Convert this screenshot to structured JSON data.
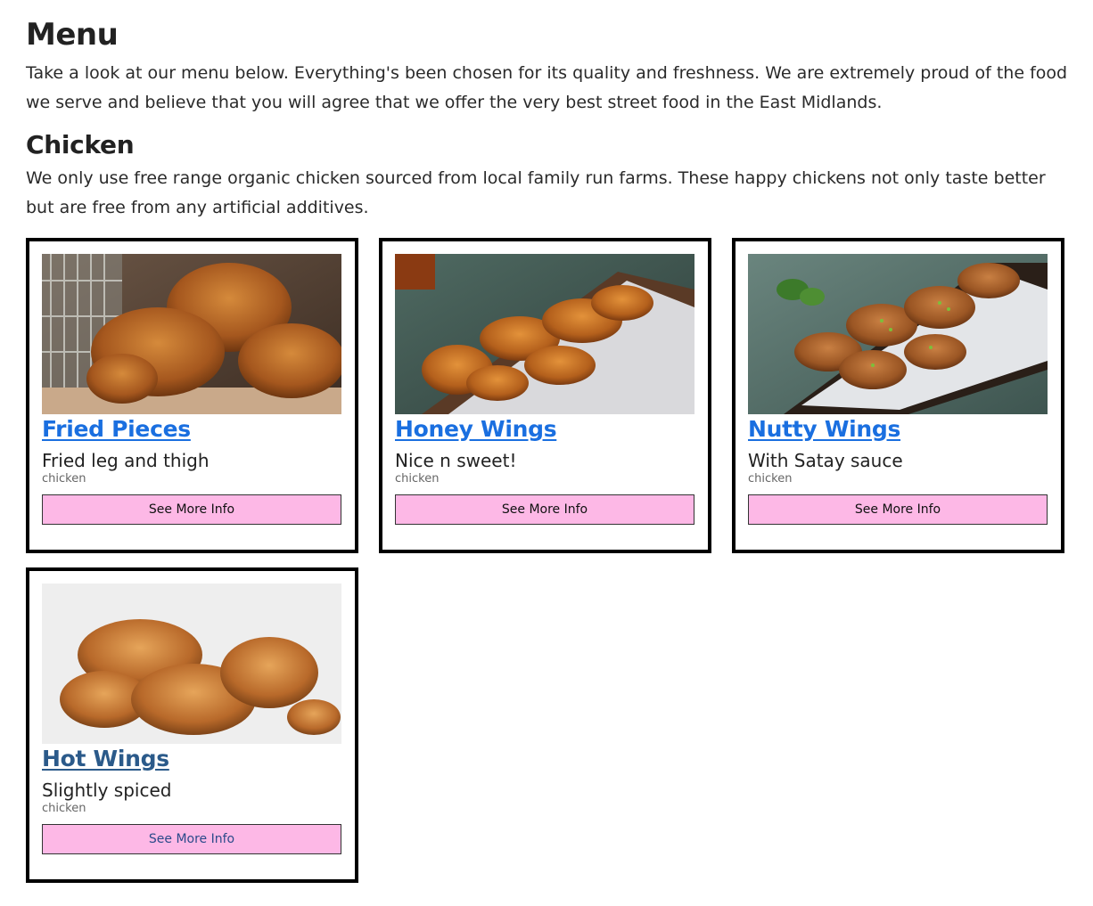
{
  "menu": {
    "title": "Menu",
    "intro": "Take a look at our menu below. Everything's been chosen for its quality and freshness. We are extremely proud of the food we serve and believe that you will agree that we offer the very best street food in the East Midlands."
  },
  "category": {
    "title": "Chicken",
    "description": "We only use free range organic chicken sourced from local family run farms. These happy chickens not only taste better but are free from any artificial additives."
  },
  "items": [
    {
      "title": "Fried Pieces",
      "description": "Fried leg and thigh",
      "category": "chicken",
      "button": "See More Info"
    },
    {
      "title": "Honey Wings",
      "description": "Nice n sweet!",
      "category": "chicken",
      "button": "See More Info"
    },
    {
      "title": "Nutty Wings",
      "description": "With Satay sauce",
      "category": "chicken",
      "button": "See More Info"
    },
    {
      "title": "Hot Wings",
      "description": "Slightly spiced",
      "category": "chicken",
      "button": "See More Info"
    }
  ],
  "colors": {
    "link": "#1a6fe0",
    "visited_link": "#2b5a8a",
    "button_bg": "#fdb8e6",
    "card_border": "#000000"
  }
}
